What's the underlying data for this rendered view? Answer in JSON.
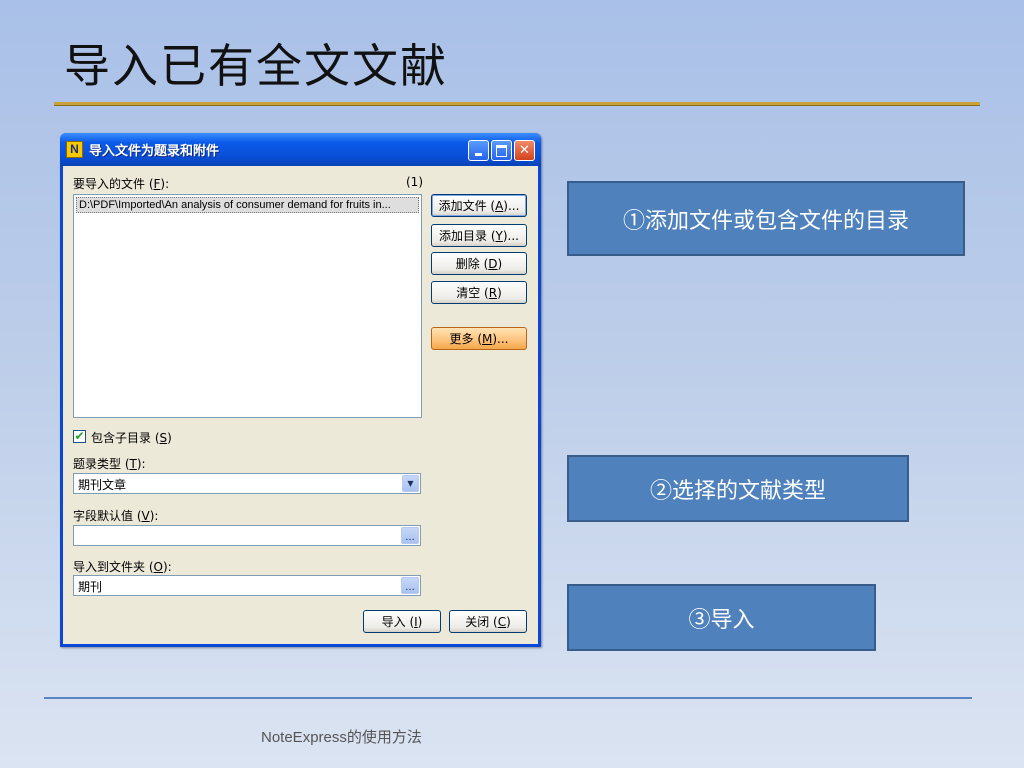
{
  "slide": {
    "title": "导入已有全文文献",
    "footer": "NoteExpress的使用方法"
  },
  "dialog": {
    "app_icon_letter": "N",
    "title": "导入文件为题录和附件",
    "files_label": "要导入的文件 (",
    "files_label_key": "F",
    "files_label_end": "):",
    "file_count": "(1)",
    "files": [
      "D:\\PDF\\Imported\\An analysis of consumer demand for fruits in..."
    ],
    "buttons": {
      "add_file": [
        "添加文件 (",
        "A",
        ")..."
      ],
      "add_dir": [
        "添加目录 (",
        "Y",
        ")..."
      ],
      "delete": [
        "删除 (",
        "D",
        ")"
      ],
      "clear": [
        "清空 (",
        "R",
        ")"
      ],
      "more": [
        "更多 (",
        "M",
        ")..."
      ],
      "import": [
        "导入 (",
        "I",
        ")"
      ],
      "close": [
        "关闭 (",
        "C",
        ")"
      ]
    },
    "include_subdirs": [
      "包含子目录 (",
      "S",
      ")"
    ],
    "record_type_label": [
      "题录类型 (",
      "T",
      "):"
    ],
    "record_type_value": "期刊文章",
    "field_default_label": [
      "字段默认值 (",
      "V",
      "):"
    ],
    "field_default_value": "",
    "folder_label": [
      "导入到文件夹 (",
      "O",
      "):"
    ],
    "folder_value": "期刊",
    "ellipsis": "..."
  },
  "callouts": {
    "step1": "①添加文件或包含文件的目录",
    "step2": "②选择的文献类型",
    "step3": "③导入"
  },
  "colors": {
    "callout_fill": "#4f81bd",
    "title_rule": "#c9a33a",
    "titlebar": "#0a4fd8"
  }
}
